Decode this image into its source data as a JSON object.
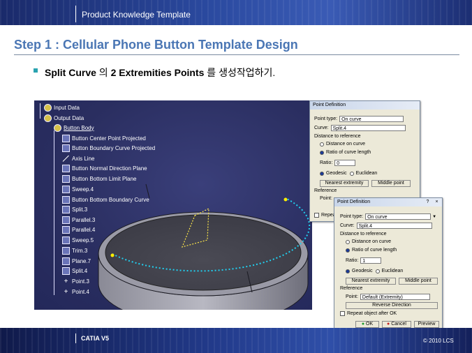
{
  "header": {
    "title": "Product Knowledge Template"
  },
  "slide": {
    "title": "Step 1 : Cellular Phone Button Template Design",
    "bullet": {
      "part1": "Split Curve",
      "part2": " 의 ",
      "part3": "2 Extremities Points",
      "part4": " 를 생성작업하기."
    }
  },
  "tree": {
    "items": [
      {
        "label": "Input Data",
        "icon": "gear-icon"
      },
      {
        "label": "Output Data",
        "icon": "gear-icon"
      },
      {
        "label": "Button Body",
        "icon": "gear-icon"
      },
      {
        "label": "Button Center Point Projected",
        "icon": "point-icon"
      },
      {
        "label": "Button Boundary Curve Projected",
        "icon": "curve-icon"
      },
      {
        "label": "Axis Line",
        "icon": "line-icon"
      },
      {
        "label": "Button Normal Direction Plane",
        "icon": "plane-icon"
      },
      {
        "label": "Button Bottom Limit Plane",
        "icon": "plane-icon"
      },
      {
        "label": "Sweep.4",
        "icon": "sweep-icon"
      },
      {
        "label": "Button Bottom Boundary Curve",
        "icon": "curve-icon"
      },
      {
        "label": "Split.3",
        "icon": "split-icon"
      },
      {
        "label": "Parallel.3",
        "icon": "parallel-icon"
      },
      {
        "label": "Parallel.4",
        "icon": "parallel-icon"
      },
      {
        "label": "Sweep.5",
        "icon": "sweep-icon"
      },
      {
        "label": "Trim.3",
        "icon": "trim-icon"
      },
      {
        "label": "Plane.7",
        "icon": "plane-icon"
      },
      {
        "label": "Split.4",
        "icon": "split-icon"
      },
      {
        "label": "Point.3",
        "icon": "point-icon"
      },
      {
        "label": "Point.4",
        "icon": "point-icon"
      }
    ]
  },
  "dialog_back": {
    "title": "Point Definition",
    "point_type_label": "Point type:",
    "point_type_value": "On curve",
    "curve_label": "Curve:",
    "curve_value": "Split.4",
    "distance_group": "Distance to reference",
    "opt_distance": "Distance on curve",
    "opt_ratio": "Ratio of curve length",
    "ratio_label": "Ratio:",
    "ratio_value": "0",
    "opt_geodesic": "Geodesic",
    "opt_euclidean": "Euclidean",
    "btn_nearest": "Nearest extremity",
    "btn_middle": "Middle point",
    "reference_group": "Reference",
    "point_label": "Point:",
    "repeat_label": "Repeat"
  },
  "dialog_front": {
    "title": "Point Definition",
    "point_type_label": "Point type:",
    "point_type_value": "On curve",
    "curve_label": "Curve:",
    "curve_value": "Split.4",
    "distance_group": "Distance to reference",
    "opt_distance": "Distance on curve",
    "opt_ratio": "Ratio of curve length",
    "ratio_label": "Ratio:",
    "ratio_value": "1",
    "opt_geodesic": "Geodesic",
    "opt_euclidean": "Euclidean",
    "btn_nearest": "Nearest extremity",
    "btn_middle": "Middle point",
    "reference_group": "Reference",
    "point_label": "Point:",
    "point_value": "Default (Extremity)",
    "btn_reverse": "Reverse Direction",
    "repeat_label": "Repeat object after OK",
    "btn_ok": "OK",
    "btn_cancel": "Cancel",
    "btn_preview": "Preview"
  },
  "footer": {
    "left": "CATIA V5",
    "right": "© 2010 LCS"
  }
}
